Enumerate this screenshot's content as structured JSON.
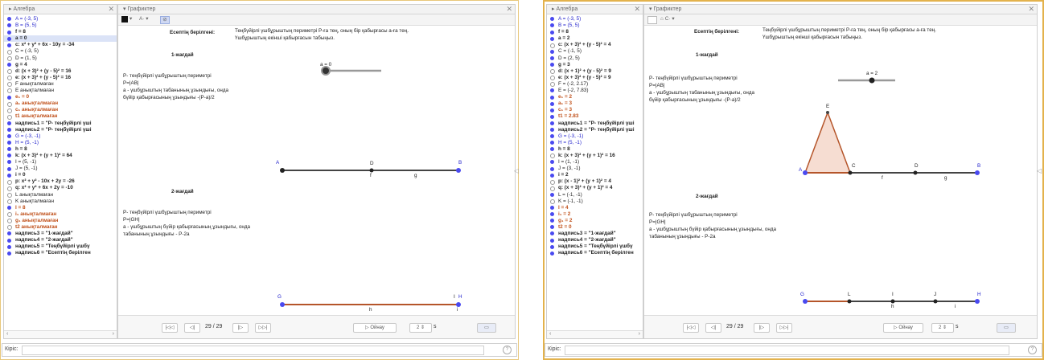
{
  "colors": {
    "point": "#4a4af0",
    "segment_dark": "#444444",
    "segment_orange": "#b5552a",
    "triangle_fill": "#f6ddd2",
    "accent_orange": "#c0501a"
  },
  "window1": {
    "algebra": {
      "title": "Алгебра",
      "items": [
        {
          "text": "A = (-3, 5)",
          "style": "blue",
          "dot": "on"
        },
        {
          "text": "B = (5, 5)",
          "style": "blue",
          "dot": "on"
        },
        {
          "text": "f = 8",
          "style": "bold",
          "dot": "on"
        },
        {
          "text": "a = 0",
          "style": "bold",
          "dot": "on",
          "selected": true
        },
        {
          "text": "c: x² + y² + 6x - 10y = -34",
          "style": "bold",
          "dot": "on"
        },
        {
          "text": "C = (-3, 5)",
          "style": "plain",
          "dot": "off"
        },
        {
          "text": "D = (1, 5)",
          "style": "plain",
          "dot": "off"
        },
        {
          "text": "g = 4",
          "style": "bold",
          "dot": "on"
        },
        {
          "text": "d: (x + 3)² + (y - 5)² = 16",
          "style": "bold",
          "dot": "off"
        },
        {
          "text": "e: (x + 3)² + (y - 5)² = 16",
          "style": "bold",
          "dot": "off"
        },
        {
          "text": "F анықталмаған",
          "style": "plain",
          "dot": "off"
        },
        {
          "text": "E анықталмаған",
          "style": "plain",
          "dot": "off"
        },
        {
          "text": "e₁ = 0",
          "style": "orange",
          "dot": "on"
        },
        {
          "text": "a₁ анықталмаған",
          "style": "orange",
          "dot": "off"
        },
        {
          "text": "c₁ анықталмаған",
          "style": "orange",
          "dot": "off"
        },
        {
          "text": "t1 анықталмаған",
          "style": "orange",
          "dot": "off"
        },
        {
          "text": "надпись1 = \"P- теңбүйірлі үшi",
          "style": "bold",
          "dot": "on"
        },
        {
          "text": "надпись2 = \"P- теңбүйірлі үшi",
          "style": "bold",
          "dot": "on"
        },
        {
          "text": "G = (-3, -1)",
          "style": "blue",
          "dot": "on"
        },
        {
          "text": "H = (5, -1)",
          "style": "blue",
          "dot": "on"
        },
        {
          "text": "h = 8",
          "style": "bold",
          "dot": "on"
        },
        {
          "text": "k: (x + 3)² + (y + 1)² = 64",
          "style": "bold",
          "dot": "on"
        },
        {
          "text": "I = (5, -1)",
          "style": "plain",
          "dot": "on"
        },
        {
          "text": "J = (5, -1)",
          "style": "plain",
          "dot": "on"
        },
        {
          "text": "i = 0",
          "style": "bold",
          "dot": "on"
        },
        {
          "text": "p: x² + y² - 10x + 2y = -26",
          "style": "bold",
          "dot": "off"
        },
        {
          "text": "q: x² + y² + 6x + 2y = -10",
          "style": "bold",
          "dot": "off"
        },
        {
          "text": "L анықталмаған",
          "style": "plain",
          "dot": "off"
        },
        {
          "text": "K анықталмаған",
          "style": "plain",
          "dot": "off"
        },
        {
          "text": "l = 8",
          "style": "orange",
          "dot": "on"
        },
        {
          "text": "i₁ анықталмаған",
          "style": "orange",
          "dot": "off"
        },
        {
          "text": "g₁ анықталмаған",
          "style": "orange",
          "dot": "off"
        },
        {
          "text": "t2 анықталмаған",
          "style": "orange",
          "dot": "off"
        },
        {
          "text": "надпись3 = \"1-жағдай\"",
          "style": "bold",
          "dot": "on"
        },
        {
          "text": "надпись4 = \"2-жағдай\"",
          "style": "bold",
          "dot": "on"
        },
        {
          "text": "надпись5 = \"Теңбүйірлі үшбү",
          "style": "bold",
          "dot": "on"
        },
        {
          "text": "надпись6 = \"Есептің берілген",
          "style": "bold",
          "dot": "on"
        }
      ]
    },
    "graphics": {
      "title": "Графиктер",
      "given_label": "Есептің берілгені:",
      "given_text_1": "Теңбүйірлі үшбұрыштың периметрі P-ға тең, оның бір қабырғасы a-ға тең.",
      "given_text_2": "Үшбұрыштың екінші қабырғасын табыңыз.",
      "case1": "1-жағдай",
      "case2": "2-жағдай",
      "c1_l1": "P- теңбүйірлі үшбұрыштың периметрі",
      "c1_l2": "P=|AB|",
      "c1_l3": "a - үшбұрыштың табанының ұзындығы, онда",
      "c1_l4": "бүйір қабырғасының ұзындығы -(P-a)/2",
      "c2_l1": "P- теңбүйірлі үшбұрыштың периметрі",
      "c2_l2": "P=|GH|",
      "c2_l3": "a - үшбұрыштың бүйір қабырғасының ұзындығы, онда",
      "c2_l4": "табанының ұзындығы - P-2a",
      "slider_label": "a = 0",
      "slider_value": 0,
      "pt_A": "A",
      "pt_B": "B",
      "pt_D": "D",
      "lbl_f": "f",
      "lbl_g": "g",
      "pt_G": "G",
      "pt_H": "H",
      "pt_I": "I",
      "lbl_h": "h",
      "lbl_i": "i"
    },
    "nav": {
      "page": "29 / 29",
      "play": "Ойнау",
      "speed": "2",
      "unit": "s"
    },
    "input_label": "Кіріс:"
  },
  "window2": {
    "algebra": {
      "title": "Алгебра",
      "items": [
        {
          "text": "A = (-3, 5)",
          "style": "blue",
          "dot": "on"
        },
        {
          "text": "B = (5, 5)",
          "style": "blue",
          "dot": "on"
        },
        {
          "text": "f = 8",
          "style": "bold",
          "dot": "on"
        },
        {
          "text": "a = 2",
          "style": "bold",
          "dot": "on"
        },
        {
          "text": "c: (x + 3)² + (y - 5)² = 4",
          "style": "bold",
          "dot": "off"
        },
        {
          "text": "C = (-1, 5)",
          "style": "plain",
          "dot": "on"
        },
        {
          "text": "D = (2, 5)",
          "style": "plain",
          "dot": "on"
        },
        {
          "text": "g = 3",
          "style": "bold",
          "dot": "on"
        },
        {
          "text": "d: (x + 1)² + (y - 5)² = 9",
          "style": "bold",
          "dot": "off"
        },
        {
          "text": "e: (x + 3)² + (y - 5)² = 9",
          "style": "bold",
          "dot": "off"
        },
        {
          "text": "F = (-2, 2.17)",
          "style": "plain",
          "dot": "off"
        },
        {
          "text": "E = (-2, 7.83)",
          "style": "plain",
          "dot": "on"
        },
        {
          "text": "e₁ = 2",
          "style": "orange",
          "dot": "on"
        },
        {
          "text": "a₁ = 3",
          "style": "orange",
          "dot": "on"
        },
        {
          "text": "c₁ = 3",
          "style": "orange",
          "dot": "on"
        },
        {
          "text": "t1 = 2.83",
          "style": "orange",
          "dot": "on"
        },
        {
          "text": "надпись1 = \"P- теңбүйірлі үші",
          "style": "bold",
          "dot": "on"
        },
        {
          "text": "надпись2 = \"P- теңбүйірлі үші",
          "style": "bold",
          "dot": "on"
        },
        {
          "text": "G = (-3, -1)",
          "style": "blue",
          "dot": "on"
        },
        {
          "text": "H = (5, -1)",
          "style": "blue",
          "dot": "on"
        },
        {
          "text": "h = 8",
          "style": "bold",
          "dot": "on"
        },
        {
          "text": "k: (x + 3)² + (y + 1)² = 16",
          "style": "bold",
          "dot": "off"
        },
        {
          "text": "I = (1, -1)",
          "style": "plain",
          "dot": "on"
        },
        {
          "text": "J = (3, -1)",
          "style": "plain",
          "dot": "on"
        },
        {
          "text": "i = 2",
          "style": "bold",
          "dot": "on"
        },
        {
          "text": "p: (x - 1)² + (y + 1)² = 4",
          "style": "bold",
          "dot": "off"
        },
        {
          "text": "q: (x + 3)² + (y + 1)² = 4",
          "style": "bold",
          "dot": "off"
        },
        {
          "text": "L = (-1, -1)",
          "style": "plain",
          "dot": "on"
        },
        {
          "text": "K = (-1, -1)",
          "style": "plain",
          "dot": "off"
        },
        {
          "text": "l = 4",
          "style": "orange",
          "dot": "on"
        },
        {
          "text": "i₁ = 2",
          "style": "orange",
          "dot": "on"
        },
        {
          "text": "g₁ = 2",
          "style": "orange",
          "dot": "on"
        },
        {
          "text": "t2 = 0",
          "style": "orange",
          "dot": "on"
        },
        {
          "text": "надпись3 = \"1-жағдай\"",
          "style": "bold",
          "dot": "on"
        },
        {
          "text": "надпись4 = \"2-жағдай\"",
          "style": "bold",
          "dot": "on"
        },
        {
          "text": "надпись5 = \"Теңбүйірлі үшбү",
          "style": "bold",
          "dot": "on"
        },
        {
          "text": "надпись6 = \"Есептің берілген",
          "style": "bold",
          "dot": "on"
        }
      ]
    },
    "graphics": {
      "title": "Графиктер",
      "given_label": "Есептің берілгені:",
      "given_text_1": "Теңбүйірлі үшбұрыштың периметрі P-ға тең, оның бір қабырғасы a-ға тең.",
      "given_text_2": "Үшбұрыштың екінші қабырғасын табыңыз.",
      "case1": "1-жағдай",
      "case2": "2-жағдай",
      "c1_l1": "P- теңбүйірлі үшбұрыштың периметрі",
      "c1_l2": "P=|AB|",
      "c1_l3": "a - үшбұрыштың табанының ұзындығы, онда",
      "c1_l4": "бүйір қабырғасының ұзындығы -(P-a)/2",
      "c2_l1": "P- теңбүйірлі үшбұрыштың периметрі",
      "c2_l2": "P=|GH|",
      "c2_l3": "a - үшбұрыштың бүйір қабырғасының ұзындығы, онда",
      "c2_l4": "табанының ұзындығы - P-2a",
      "slider_label": "a = 2",
      "slider_value": 2,
      "pt_A": "A",
      "pt_B": "B",
      "pt_C": "C",
      "pt_D": "D",
      "pt_E": "E",
      "lbl_f": "f",
      "lbl_g": "g",
      "pt_G": "G",
      "pt_H": "H",
      "pt_L": "L",
      "pt_I": "I",
      "pt_J": "J",
      "lbl_h": "h",
      "lbl_i": "i"
    },
    "nav": {
      "page": "29 / 29",
      "play": "Ойнау",
      "speed": "2",
      "unit": "s"
    },
    "input_label": "Кіріс:"
  }
}
